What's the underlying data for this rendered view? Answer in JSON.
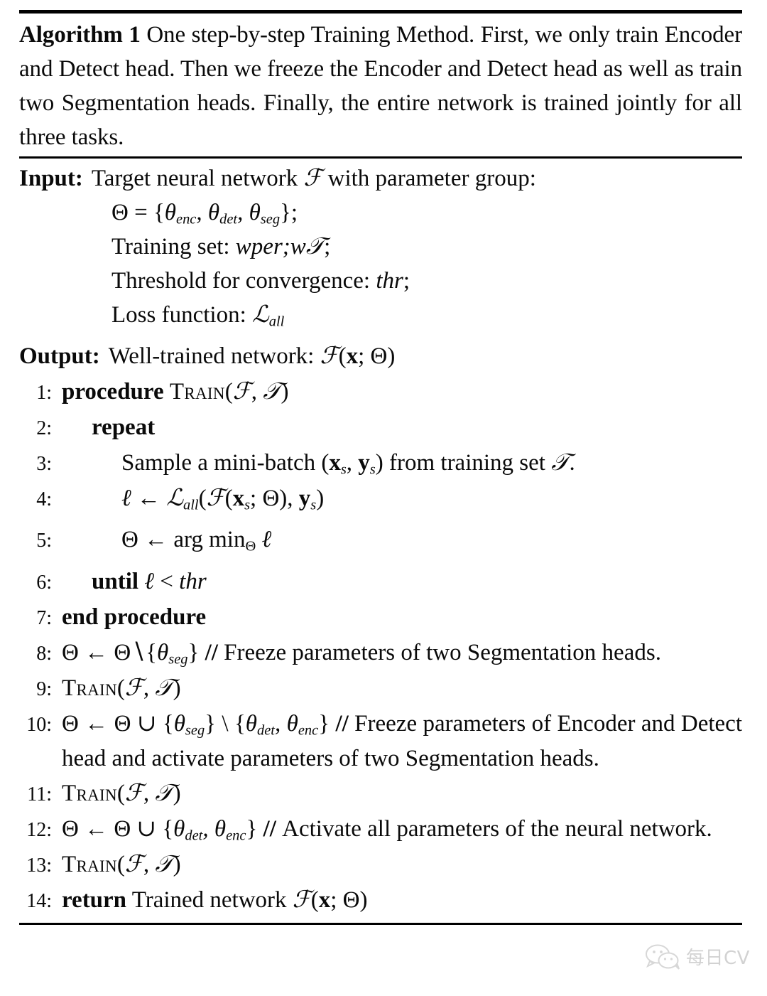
{
  "algorithm": {
    "label": "Algorithm 1",
    "title": "One step-by-step Training Method. First, we only train Encoder and Detect head. Then we freeze the Encoder and Detect head as well as train two Segmentation heads. Finally, the entire network is trained jointly for all three tasks.",
    "io": {
      "input_key": "Input:",
      "input_lines": [
        "Target neural network ℱ with parameter group:",
        "Θ = {θenc, θdet, θseg};",
        "Training set: 𝒯;",
        "Threshold for convergence: thr;",
        "Loss function: ℒall"
      ],
      "output_key": "Output:",
      "output_line": "Well-trained network: ℱ(x; Θ)"
    },
    "steps": [
      {
        "num": "1:",
        "indent": 0,
        "text": "procedure TRAIN(ℱ, 𝒯)"
      },
      {
        "num": "2:",
        "indent": 1,
        "text": "repeat"
      },
      {
        "num": "3:",
        "indent": 2,
        "text": "Sample a mini-batch (xs, ys) from training set 𝒯."
      },
      {
        "num": "4:",
        "indent": 2,
        "text": "ℓ ← ℒall(ℱ(xs; Θ), ys)"
      },
      {
        "num": "5:",
        "indent": 2,
        "text": "Θ ← arg minΘ ℓ"
      },
      {
        "num": "6:",
        "indent": 1,
        "text": "until ℓ < thr"
      },
      {
        "num": "7:",
        "indent": 0,
        "text": "end procedure"
      },
      {
        "num": "8:",
        "indent": 0,
        "text": "Θ ← Θ \\ {θseg} // Freeze parameters of two Segmentation heads."
      },
      {
        "num": "9:",
        "indent": 0,
        "text": "TRAIN(ℱ, 𝒯)"
      },
      {
        "num": "10:",
        "indent": 0,
        "text": "Θ ← Θ ∪ {θseg} \\ {θdet, θenc} // Freeze parameters of Encoder and Detect head and activate parameters of two Segmentation heads."
      },
      {
        "num": "11:",
        "indent": 0,
        "text": "TRAIN(ℱ, 𝒯)"
      },
      {
        "num": "12:",
        "indent": 0,
        "text": "Θ ← Θ ∪ {θdet, θenc} // Activate all parameters of the neural network."
      },
      {
        "num": "13:",
        "indent": 0,
        "text": "TRAIN(ℱ, 𝒯)"
      },
      {
        "num": "14:",
        "indent": 0,
        "text": "return Trained network ℱ(x; Θ)"
      }
    ]
  },
  "watermark": {
    "icon": "wechat-icon",
    "text": "每日CV",
    "color": "#c9c9c9"
  },
  "colors": {
    "text": "#0a0a0a",
    "rule": "#000000",
    "background": "#ffffff"
  }
}
